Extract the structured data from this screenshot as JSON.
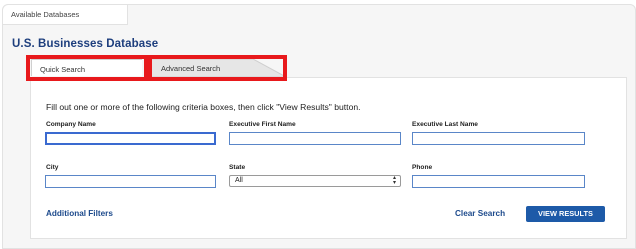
{
  "top_tab": {
    "label": "Available Databases"
  },
  "database_title": "U.S. Businesses Database",
  "search_tabs": [
    {
      "label": "Quick Search",
      "active": true
    },
    {
      "label": "Advanced Search",
      "active": false
    }
  ],
  "form": {
    "instructions": "Fill out one or more of the following criteria boxes, then click \"View Results\" button.",
    "company_name": {
      "label": "Company Name",
      "value": ""
    },
    "exec_first": {
      "label": "Executive First Name",
      "value": ""
    },
    "exec_last": {
      "label": "Executive Last Name",
      "value": ""
    },
    "city": {
      "label": "City",
      "value": ""
    },
    "state": {
      "label": "State",
      "selected": "All"
    },
    "phone": {
      "label": "Phone",
      "value": ""
    }
  },
  "actions": {
    "additional_filters": "Additional Filters",
    "clear_search": "Clear Search",
    "view_results": "VIEW RESULTS"
  },
  "colors": {
    "title": "#1d3e7d",
    "link": "#1d4a8c",
    "button": "#1d5aa8",
    "highlight": "#e8191c"
  }
}
